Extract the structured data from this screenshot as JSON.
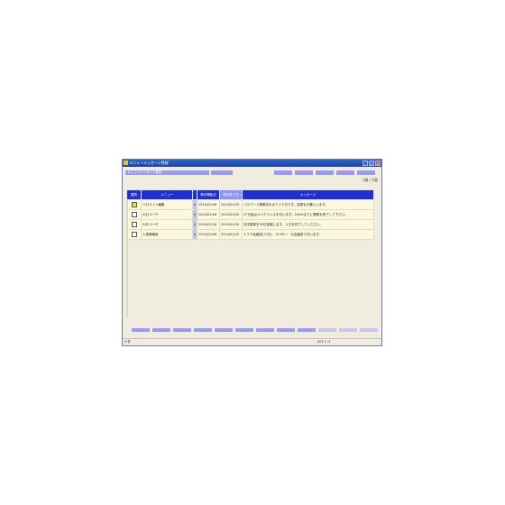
{
  "window": {
    "title": "メニューメッセージ登録",
    "controls": {
      "minimize": "_",
      "maximize": "□",
      "close": "×"
    }
  },
  "form": {
    "title_label": "メニューメッセージ登録"
  },
  "pager": {
    "text": "1頁 / 1頁"
  },
  "table": {
    "headers": [
      "選択",
      "メニュー",
      "",
      "掲示開始日",
      "掲示終了日",
      "メッセージ"
    ],
    "rows": [
      {
        "menu": "ベロライン編集",
        "sel": "▾",
        "start": "2014/01/06",
        "end": "2014/01/20",
        "message": "パスワード期限切れまで１０日です。変更をお願いします。"
      },
      {
        "menu": "わおユーザ",
        "sel": "▾",
        "start": "2014/01/06",
        "end": "2014/01/20",
        "message": "27日金はメンテナンスを行います。16:00までに業務を終了して下さい。"
      },
      {
        "menu": "わおユーザ",
        "sel": "▾",
        "start": "2014/01/16",
        "end": "2014/01/20",
        "message": "月次更新を30日実施します。入力を完了してください。"
      },
      {
        "menu": "人事情報用",
        "sel": "▾",
        "start": "2014/01/06",
        "end": "2014/01/20",
        "message": "１５０会議室(17日)　15:00～　大会議室で行います。"
      }
    ]
  },
  "status": {
    "left": "4 件",
    "right": "001 1 :2"
  }
}
